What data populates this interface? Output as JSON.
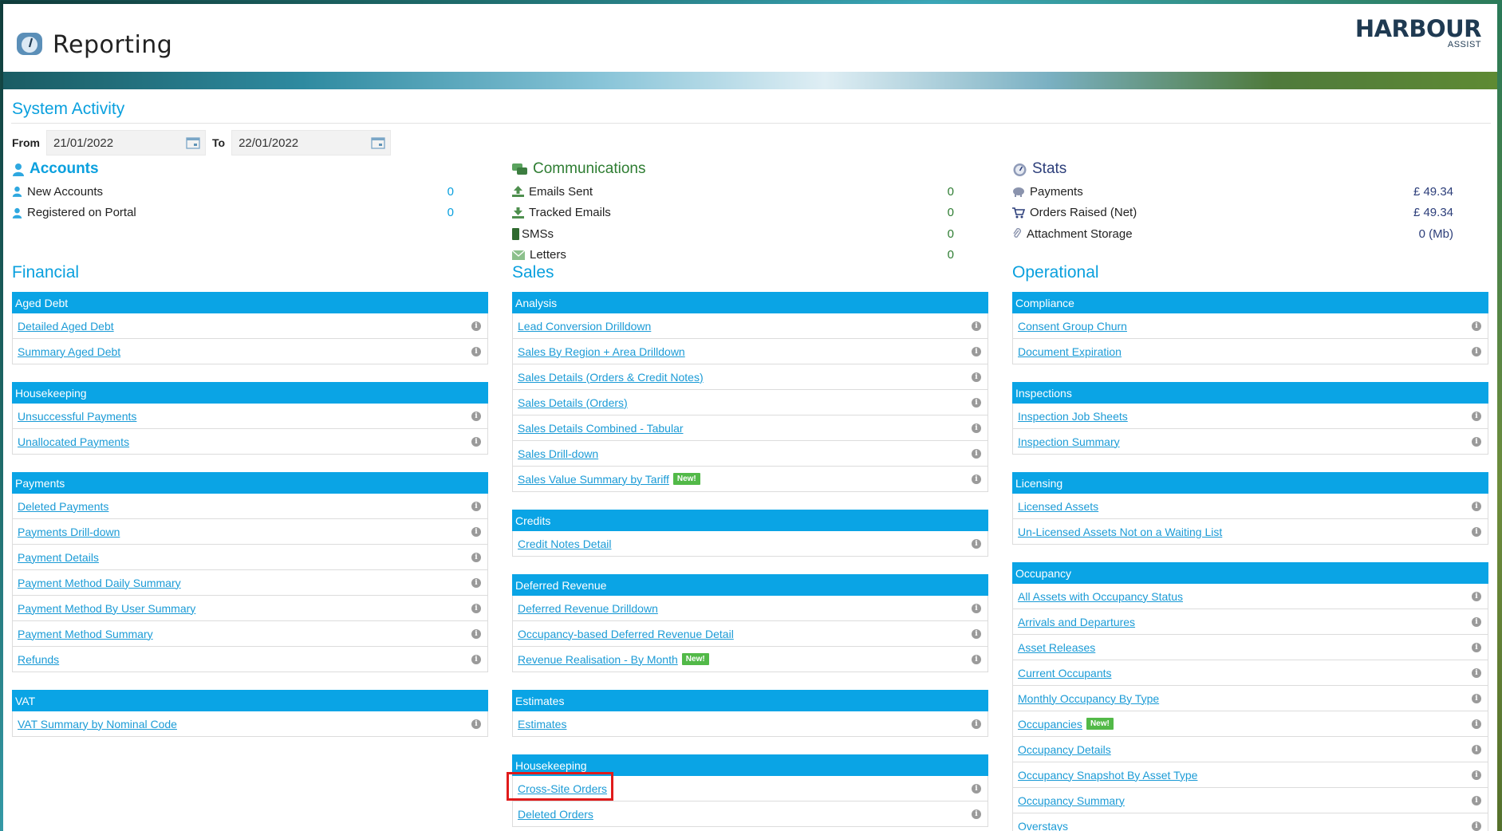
{
  "header": {
    "title": "Reporting",
    "logo_main": "HARBOUR",
    "logo_sub": "ASSIST"
  },
  "system_activity": {
    "title": "System Activity",
    "from_label": "From",
    "from_value": "21/01/2022",
    "to_label": "To",
    "to_value": "22/01/2022"
  },
  "accounts": {
    "title": "Accounts",
    "rows": [
      {
        "label": "New Accounts",
        "value": "0"
      },
      {
        "label": "Registered on Portal",
        "value": "0"
      }
    ]
  },
  "communications": {
    "title": "Communications",
    "rows": [
      {
        "label": "Emails Sent",
        "value": "0"
      },
      {
        "label": "Tracked Emails",
        "value": "0"
      },
      {
        "label": "SMSs",
        "value": "0"
      },
      {
        "label": "Letters",
        "value": "0"
      }
    ]
  },
  "stats": {
    "title": "Stats",
    "rows": [
      {
        "label": "Payments",
        "value": "£ 49.34"
      },
      {
        "label": "Orders Raised (Net)",
        "value": "£ 49.34"
      },
      {
        "label": "Attachment Storage",
        "value": "0 (Mb)"
      }
    ]
  },
  "financial": {
    "title": "Financial",
    "groups": [
      {
        "title": "Aged Debt",
        "items": [
          {
            "label": "Detailed Aged Debt"
          },
          {
            "label": "Summary Aged Debt"
          }
        ]
      },
      {
        "title": "Housekeeping",
        "items": [
          {
            "label": "Unsuccessful Payments"
          },
          {
            "label": "Unallocated Payments"
          }
        ]
      },
      {
        "title": "Payments",
        "items": [
          {
            "label": "Deleted Payments"
          },
          {
            "label": "Payments Drill-down"
          },
          {
            "label": "Payment Details"
          },
          {
            "label": "Payment Method Daily Summary"
          },
          {
            "label": "Payment Method By User Summary"
          },
          {
            "label": "Payment Method Summary"
          },
          {
            "label": "Refunds"
          }
        ]
      },
      {
        "title": "VAT",
        "items": [
          {
            "label": "VAT Summary by Nominal Code"
          }
        ]
      }
    ]
  },
  "sales": {
    "title": "Sales",
    "groups": [
      {
        "title": "Analysis",
        "items": [
          {
            "label": "Lead Conversion Drilldown"
          },
          {
            "label": "Sales By Region + Area Drilldown"
          },
          {
            "label": "Sales Details (Orders & Credit Notes)"
          },
          {
            "label": "Sales Details (Orders)"
          },
          {
            "label": "Sales Details Combined - Tabular"
          },
          {
            "label": "Sales Drill-down"
          },
          {
            "label": "Sales Value Summary by Tariff",
            "badge": "New!"
          }
        ]
      },
      {
        "title": "Credits",
        "items": [
          {
            "label": "Credit Notes Detail"
          }
        ]
      },
      {
        "title": "Deferred Revenue",
        "items": [
          {
            "label": "Deferred Revenue Drilldown"
          },
          {
            "label": "Occupancy-based Deferred Revenue Detail"
          },
          {
            "label": "Revenue Realisation - By Month",
            "badge": "New!"
          }
        ]
      },
      {
        "title": "Estimates",
        "items": [
          {
            "label": "Estimates"
          }
        ]
      },
      {
        "title": "Housekeeping",
        "items": [
          {
            "label": "Cross-Site Orders"
          },
          {
            "label": "Deleted Orders"
          }
        ]
      }
    ]
  },
  "operational": {
    "title": "Operational",
    "groups": [
      {
        "title": "Compliance",
        "items": [
          {
            "label": "Consent Group Churn"
          },
          {
            "label": "Document Expiration"
          }
        ]
      },
      {
        "title": "Inspections",
        "items": [
          {
            "label": "Inspection Job Sheets"
          },
          {
            "label": "Inspection Summary"
          }
        ]
      },
      {
        "title": "Licensing",
        "items": [
          {
            "label": "Licensed Assets"
          },
          {
            "label": "Un-Licensed Assets Not on a Waiting List"
          }
        ]
      },
      {
        "title": "Occupancy",
        "items": [
          {
            "label": "All Assets with Occupancy Status"
          },
          {
            "label": "Arrivals and Departures"
          },
          {
            "label": "Asset Releases"
          },
          {
            "label": "Current Occupants"
          },
          {
            "label": "Monthly Occupancy By Type"
          },
          {
            "label": "Occupancies",
            "badge": "New!"
          },
          {
            "label": "Occupancy Details"
          },
          {
            "label": "Occupancy Snapshot By Asset Type"
          },
          {
            "label": "Occupancy Summary"
          },
          {
            "label": "Overstays"
          }
        ]
      }
    ]
  },
  "colors": {
    "accent": "#0aa4e5",
    "comms_green": "#2e7d32",
    "stats_navy": "#2c3e7a",
    "badge_green": "#52b948",
    "highlight_red": "#e01b1b"
  },
  "icons": {
    "title": "dashboard-gauge-icon",
    "accounts": "user-icon",
    "communications": "chat-bubbles-icon",
    "stats": "speedometer-icon",
    "calendar": "calendar-icon",
    "info": "info-icon"
  }
}
